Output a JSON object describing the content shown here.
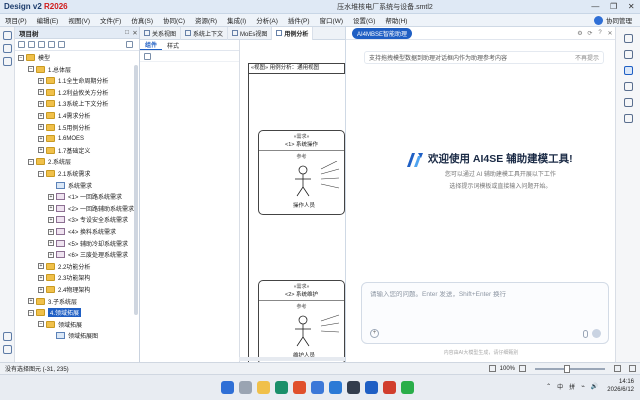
{
  "window": {
    "app_name": "Design v2 ",
    "app_version": "R2026",
    "doc_title": "压水堆核电厂系统与设备.smtl2",
    "controls": [
      "—",
      "❐",
      "✕"
    ]
  },
  "menubar": {
    "items": [
      "项目(P)",
      "编辑(E)",
      "视图(V)",
      "文件(F)",
      "仿真(S)",
      "协同(C)",
      "资源(R)",
      "集成(I)",
      "分析(A)",
      "插件(P)",
      "窗口(W)",
      "设置(G)",
      "帮助(H)"
    ],
    "user": "协同管理"
  },
  "tree": {
    "header": "项目树",
    "header_buttons": [
      "□",
      "✕"
    ],
    "nodes": [
      {
        "label": "模型",
        "level": 0,
        "exp": "−",
        "icon": "folder"
      },
      {
        "label": "1.总体层",
        "level": 1,
        "exp": "−",
        "icon": "folder"
      },
      {
        "label": "1.1全生命周期分析",
        "level": 2,
        "exp": "+",
        "icon": "folder"
      },
      {
        "label": "1.2利益攸关方分析",
        "level": 2,
        "exp": "+",
        "icon": "folder"
      },
      {
        "label": "1.3系统上下文分析",
        "level": 2,
        "exp": "+",
        "icon": "folder"
      },
      {
        "label": "1.4需求分析",
        "level": 2,
        "exp": "+",
        "icon": "folder"
      },
      {
        "label": "1.5用例分析",
        "level": 2,
        "exp": "+",
        "icon": "folder"
      },
      {
        "label": "1.6MOES",
        "level": 2,
        "exp": "+",
        "icon": "folder"
      },
      {
        "label": "1.7基础定义",
        "level": 2,
        "exp": "+",
        "icon": "folder"
      },
      {
        "label": "2.系统层",
        "level": 1,
        "exp": "−",
        "icon": "folder"
      },
      {
        "label": "2.1系统需求",
        "level": 2,
        "exp": "−",
        "icon": "folder"
      },
      {
        "label": "系统需求",
        "level": 3,
        "exp": "",
        "icon": "diag"
      },
      {
        "label": "<1> 一回路系统需求",
        "level": 3,
        "exp": "+",
        "icon": "req"
      },
      {
        "label": "<2> 一回路辅助系统需求",
        "level": 3,
        "exp": "+",
        "icon": "req"
      },
      {
        "label": "<3> 专设安全系统需求",
        "level": 3,
        "exp": "+",
        "icon": "req"
      },
      {
        "label": "<4> 换料系统需求",
        "level": 3,
        "exp": "+",
        "icon": "req"
      },
      {
        "label": "<5> 辅助冷却系统需求",
        "level": 3,
        "exp": "+",
        "icon": "req"
      },
      {
        "label": "<6> 三废处理系统需求",
        "level": 3,
        "exp": "+",
        "icon": "req"
      },
      {
        "label": "2.2功能分析",
        "level": 2,
        "exp": "+",
        "icon": "folder"
      },
      {
        "label": "2.3功能架构",
        "level": 2,
        "exp": "+",
        "icon": "folder"
      },
      {
        "label": "2.4物理架构",
        "level": 2,
        "exp": "+",
        "icon": "folder"
      },
      {
        "label": "3.子系统层",
        "level": 1,
        "exp": "+",
        "icon": "folder"
      },
      {
        "label": "4.领域拓展",
        "level": 1,
        "exp": "−",
        "icon": "folder",
        "selected": true
      },
      {
        "label": "领域拓展",
        "level": 2,
        "exp": "−",
        "icon": "folder"
      },
      {
        "label": "领域拓展图",
        "level": 3,
        "exp": "",
        "icon": "diag"
      }
    ]
  },
  "doc_tabs": [
    "关系视图",
    "系统上下文",
    "MoEs视图",
    "用例分析"
  ],
  "palette": {
    "tabs": [
      "组件",
      "样式"
    ],
    "scroll_label": "⌃"
  },
  "canvas": {
    "frame_title": "«视图» 用例分析：通用视图",
    "nodes": [
      {
        "stereotype": "«需求»",
        "name": "<1> 系统操作",
        "sub": "参考",
        "actor": "操作人员"
      },
      {
        "stereotype": "«需求»",
        "name": "<2> 系统维护",
        "sub": "参考",
        "actor": "维护人员"
      }
    ]
  },
  "assistant": {
    "badge": "AI4MBSE智能助理",
    "header_buttons": [
      "⚙",
      "⟳",
      "?",
      "✕"
    ],
    "notice": "支持拖拽模型数据到助理对话框内作为助理参考内容",
    "notice_dismiss": "不再提示",
    "welcome_title": "欢迎使用 AI4SE 辅助建模工具!",
    "welcome_line1": "您可以通过 AI 辅助建模工具开展以下工作",
    "welcome_line2": "选择提示词模板或直接输入问题开始。",
    "input_placeholder": "请输入您的问题。Enter 发送，Shift+Enter 换行",
    "input_add": "+",
    "disclaimer": "内容由AI大模型生成，请仔细甄别"
  },
  "statusbar": {
    "left": "没有选择图元 (-31, 235)",
    "zoom": "100%",
    "zoom_level": 0.45
  },
  "taskbar": {
    "time": "14:16",
    "date": "2026/6/12",
    "tray": [
      "⌃",
      "中",
      "拼",
      "⌁",
      "🔊"
    ],
    "apps": [
      {
        "name": "windows",
        "color": "#2f6fd6"
      },
      {
        "name": "search",
        "color": "#9aa4b2"
      },
      {
        "name": "files",
        "color": "#f0c04a"
      },
      {
        "name": "edge",
        "color": "#1a8f6a"
      },
      {
        "name": "chrome",
        "color": "#e0502c"
      },
      {
        "name": "store",
        "color": "#3c78d8"
      },
      {
        "name": "vscode",
        "color": "#2b7ad6"
      },
      {
        "name": "terminal",
        "color": "#333d4d"
      },
      {
        "name": "design",
        "color": "#1f5fc4"
      },
      {
        "name": "office",
        "color": "#d13e2e"
      },
      {
        "name": "wechat",
        "color": "#2aae4a"
      }
    ]
  }
}
